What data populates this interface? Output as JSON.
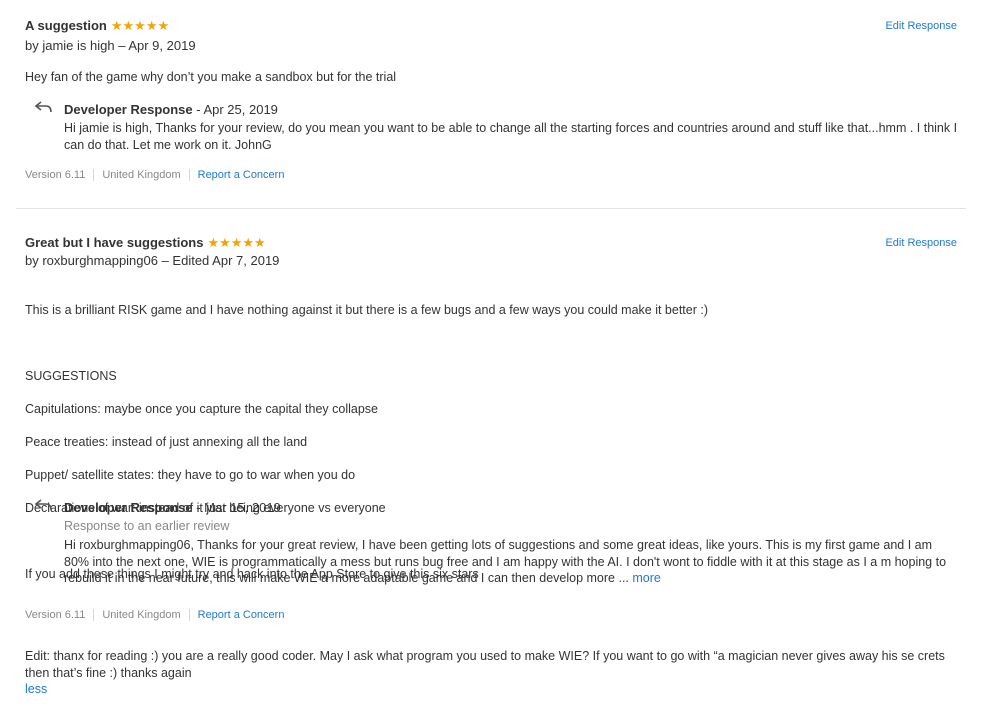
{
  "reviews": [
    {
      "title": "A suggestion",
      "stars": "★★★★★",
      "byline": "by jamie is high – Apr 9, 2019",
      "edit_label": "Edit Response",
      "body": "Hey fan of the game why don’t you make a sandbox but for the trial",
      "developer_response": {
        "label": "Developer Response",
        "date": "- Apr 25, 2019",
        "text": "Hi jamie is high, Thanks for your review, do you mean you want to be able to change all the starting forces and countries around and stuff like that...hmm . I think I can do that. Let me work on it. JohnG"
      },
      "version": "Version 6.11",
      "country": "United Kingdom",
      "report_label": "Report a Concern"
    },
    {
      "title": "Great but I have suggestions",
      "stars": "★★★★★",
      "byline": "by roxburghmapping06 – Edited Apr 7, 2019",
      "edit_label": "Edit Response",
      "body_lines": [
        "This is a brilliant RISK game and I have nothing against it but there is a few bugs and a few ways you could make it better :)",
        "",
        "SUGGESTIONS",
        "Capitulations: maybe once you capture the capital they collapse",
        "Peace treaties: instead of just annexing all the land",
        "Puppet/ satellite states: they have to go to war when you do",
        "Declarations of war: instead of it just being everyone vs everyone",
        "",
        "If you add these things I might try and hack into the App Store to give this six stars",
        "",
        "Edit: thanx for reading :) you are a really good coder. May I ask what program you used to make WIE? If you want to go with “a magician never gives away his se crets then that’s fine :) thanks again"
      ],
      "less_label": "less",
      "developer_response": {
        "label": "Developer Response",
        "date": "- Mar 15, 2019",
        "subtitle": "Response to an earlier review",
        "text": "Hi roxburghmapping06, Thanks for your great review, I have been getting lots of suggestions and some great ideas, like yours. This is my first game and I am 80% into the next one, WIE is programmatically a mess but runs bug free and I am happy with the AI. I don't wont to fiddle with it at this stage as I a m hoping to rebuild it in the near future, this will make WIE a more adaptable game and I can then develop more ...",
        "more_label": "more"
      },
      "version": "Version 6.11",
      "country": "United Kingdom",
      "report_label": "Report a Concern"
    }
  ],
  "icons": {
    "reply": "reply-arrow-icon",
    "star": "star-icon"
  },
  "colors": {
    "link": "#1f7ad1",
    "star": "#f5a300",
    "text": "#333333",
    "muted": "#888888"
  }
}
